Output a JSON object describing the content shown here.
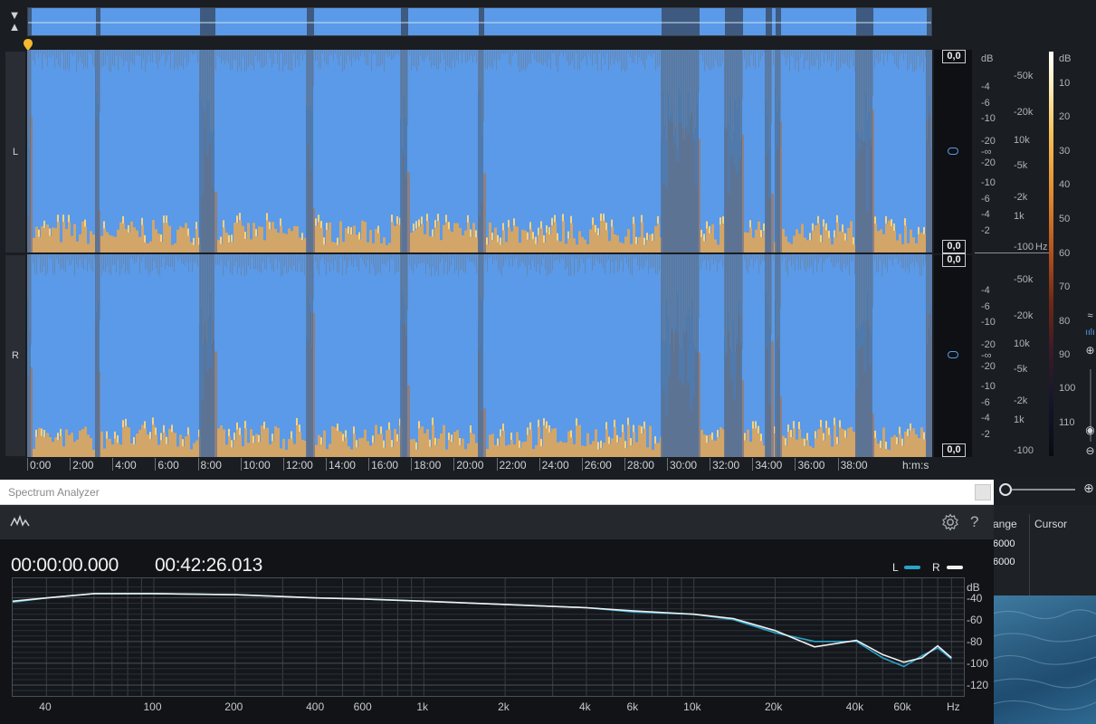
{
  "editor": {
    "collapse_icon": "double-chevron",
    "channels": [
      "L",
      "R"
    ],
    "amp_badges": [
      "0,0",
      "0,0",
      "0,0",
      "0,0"
    ],
    "amp_scale": [
      "dB",
      "-4",
      "-6",
      "-10",
      "-20",
      "-∞",
      "-20",
      "-10",
      "-6",
      "-4",
      "-2"
    ],
    "amp_scale_r": [
      "-4",
      "-6",
      "-10",
      "-20",
      "-∞",
      "-20",
      "-10",
      "-6",
      "-4",
      "-2"
    ],
    "freq_scale": [
      "-50k",
      "-20k",
      "10k",
      "-5k",
      "-2k",
      "1k",
      "-100"
    ],
    "freq_unit": "Hz",
    "freq_scale_r": [
      "-50k",
      "-20k",
      "10k",
      "-5k",
      "-2k",
      "1k",
      "-100"
    ],
    "db_scale": [
      "dB",
      "10",
      "20",
      "30",
      "40",
      "50",
      "60",
      "70",
      "80",
      "90",
      "100",
      "110"
    ],
    "timeline": [
      "0:00",
      "2:00",
      "4:00",
      "6:00",
      "8:00",
      "10:00",
      "12:00",
      "14:00",
      "16:00",
      "18:00",
      "20:00",
      "22:00",
      "24:00",
      "26:00",
      "28:00",
      "30:00",
      "32:00",
      "34:00",
      "36:00",
      "38:00"
    ],
    "timeline_unit": "h:m:s",
    "colors": {
      "waveform": "#5a9ae8",
      "background": "#1a1d21"
    }
  },
  "side_panel": {
    "col1": "ange",
    "col2": "Cursor",
    "values": [
      "6000",
      "6000"
    ]
  },
  "spectrum": {
    "title": "Spectrum Analyzer",
    "toolbar_icon": "waveform-icon",
    "settings_icon": "gear-icon",
    "help_icon": "?",
    "start_time": "00:00:00.000",
    "end_time": "00:42:26.013",
    "legend": [
      {
        "label": "L",
        "color": "#29a3c9"
      },
      {
        "label": "R",
        "color": "#f0f0f0"
      }
    ],
    "db_unit": "dB",
    "hz_unit": "Hz"
  },
  "chart_data": {
    "type": "line",
    "xlabel": "Hz",
    "ylabel": "dB",
    "x_scale": "log",
    "xlim": [
      30,
      100000
    ],
    "ylim": [
      -130,
      -22
    ],
    "x_ticks": [
      "40",
      "100",
      "200",
      "400",
      "600",
      "1k",
      "2k",
      "4k",
      "6k",
      "10k",
      "20k",
      "40k",
      "60k",
      "Hz"
    ],
    "y_ticks": [
      "-40",
      "-60",
      "-80",
      "-100",
      "-120"
    ],
    "grid": true,
    "legend_position": "top-right",
    "series": [
      {
        "name": "L",
        "color": "#29a3c9",
        "x": [
          30,
          40,
          60,
          100,
          200,
          400,
          600,
          1000,
          2000,
          4000,
          6000,
          10000,
          14000,
          20000,
          28000,
          40000,
          50000,
          60000,
          70000,
          80000,
          90000
        ],
        "y": [
          -44,
          -40,
          -36,
          -36,
          -37,
          -40,
          -41,
          -43,
          -46,
          -49,
          -53,
          -55,
          -60,
          -72,
          -80,
          -80,
          -95,
          -103,
          -93,
          -86,
          -96
        ]
      },
      {
        "name": "R",
        "color": "#f0f0f0",
        "x": [
          30,
          40,
          60,
          100,
          200,
          400,
          600,
          1000,
          2000,
          4000,
          6000,
          10000,
          14000,
          20000,
          28000,
          40000,
          50000,
          60000,
          70000,
          80000,
          90000
        ],
        "y": [
          -43,
          -40,
          -36,
          -36,
          -37,
          -40,
          -41,
          -43,
          -46,
          -49,
          -52,
          -55,
          -59,
          -70,
          -85,
          -79,
          -92,
          -99,
          -95,
          -84,
          -95
        ]
      }
    ]
  }
}
